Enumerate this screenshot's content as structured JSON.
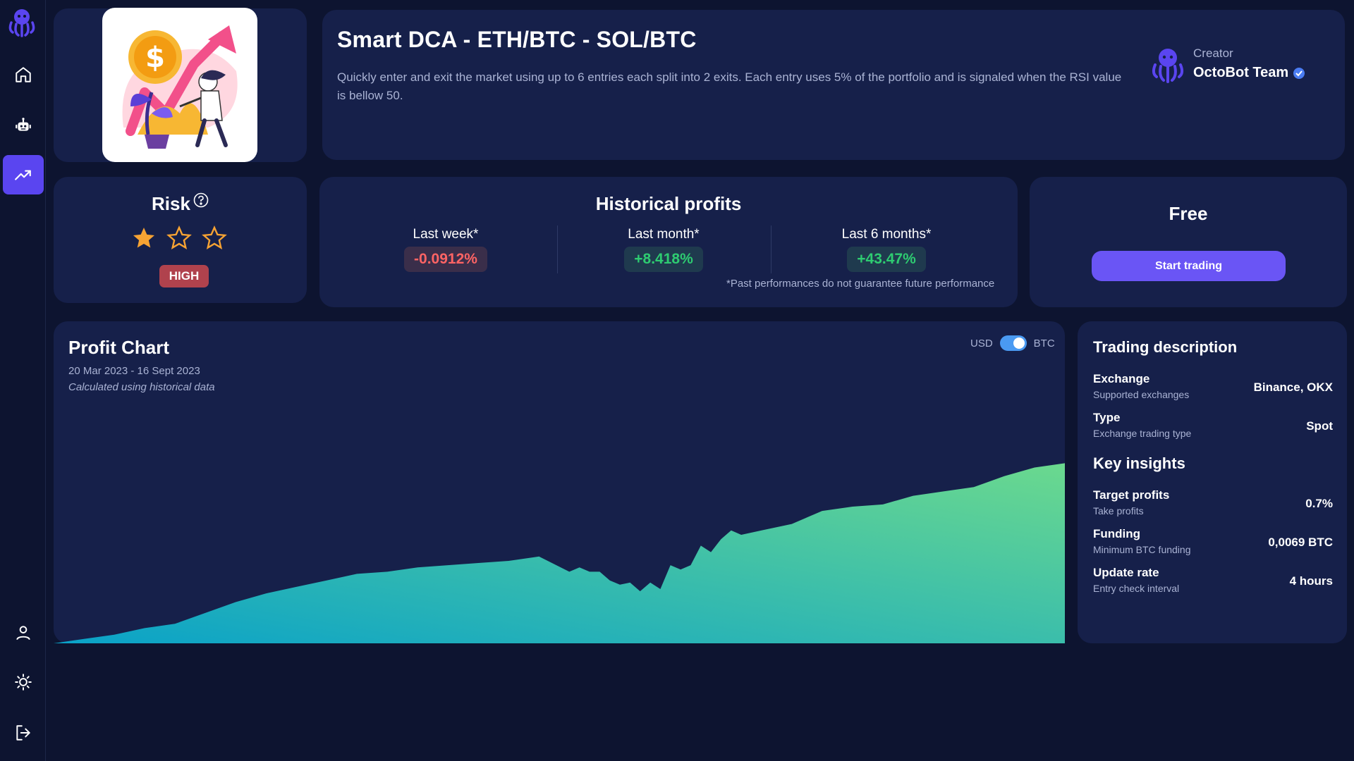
{
  "strategy": {
    "title": "Smart DCA - ETH/BTC - SOL/BTC",
    "description": "Quickly enter and exit the market using up to 6 entries each split into 2 exits. Each entry uses 5% of the portfolio and is signaled when the RSI value is bellow 50.",
    "creator_label": "Creator",
    "creator_name": "OctoBot Team"
  },
  "sidebar": {
    "items": [
      {
        "icon": "home-icon"
      },
      {
        "icon": "robot-icon"
      },
      {
        "icon": "trending-up-icon",
        "active": true
      },
      {
        "icon": "user-icon"
      },
      {
        "icon": "sun-icon"
      },
      {
        "icon": "logout-icon"
      }
    ]
  },
  "risk": {
    "title": "Risk",
    "stars_filled": 1,
    "stars_total": 3,
    "level": "HIGH"
  },
  "historical": {
    "title": "Historical profits",
    "periods": [
      {
        "label": "Last week*",
        "value": "-0.0912%",
        "positive": false
      },
      {
        "label": "Last month*",
        "value": "+8.418%",
        "positive": true
      },
      {
        "label": "Last 6 months*",
        "value": "+43.47%",
        "positive": true
      }
    ],
    "disclaimer": "*Past performances do not guarantee future performance"
  },
  "pricing": {
    "title": "Free",
    "cta": "Start trading"
  },
  "profit_chart": {
    "title": "Profit Chart",
    "dates": "20 Mar 2023 - 16 Sept 2023",
    "note": "Calculated using historical data",
    "toggle_left": "USD",
    "toggle_right": "BTC",
    "toggle_state": "BTC"
  },
  "chart_data": {
    "type": "area",
    "title": "Profit Chart",
    "x": [
      0,
      3,
      6,
      9,
      12,
      15,
      18,
      21,
      24,
      27,
      30,
      33,
      36,
      39,
      42,
      45,
      48,
      51,
      52,
      53,
      54,
      55,
      56,
      57,
      58,
      59,
      60,
      61,
      62,
      63,
      64,
      65,
      66,
      67,
      68,
      70,
      73,
      76,
      79,
      82,
      85,
      88,
      91,
      94,
      97,
      100
    ],
    "values": [
      0,
      2,
      4,
      7,
      9,
      14,
      19,
      23,
      26,
      29,
      32,
      33,
      35,
      36,
      37,
      38,
      40,
      33,
      35,
      33,
      33,
      29,
      27,
      28,
      24,
      28,
      25,
      36,
      34,
      36,
      45,
      42,
      48,
      52,
      50,
      52,
      55,
      61,
      63,
      64,
      68,
      70,
      72,
      77,
      81,
      83
    ],
    "colors": [
      "#0aa2c8",
      "#6bd98e"
    ]
  },
  "trading_description": {
    "title": "Trading description",
    "rows": [
      {
        "key": "Exchange",
        "sub": "Supported exchanges",
        "value": "Binance, OKX"
      },
      {
        "key": "Type",
        "sub": "Exchange trading type",
        "value": "Spot"
      }
    ],
    "insights_title": "Key insights",
    "insights": [
      {
        "key": "Target profits",
        "sub": "Take profits",
        "value": "0.7%"
      },
      {
        "key": "Funding",
        "sub": "Minimum BTC funding",
        "value": "0,0069 BTC"
      },
      {
        "key": "Update rate",
        "sub": "Entry check interval",
        "value": "4 hours"
      }
    ]
  }
}
